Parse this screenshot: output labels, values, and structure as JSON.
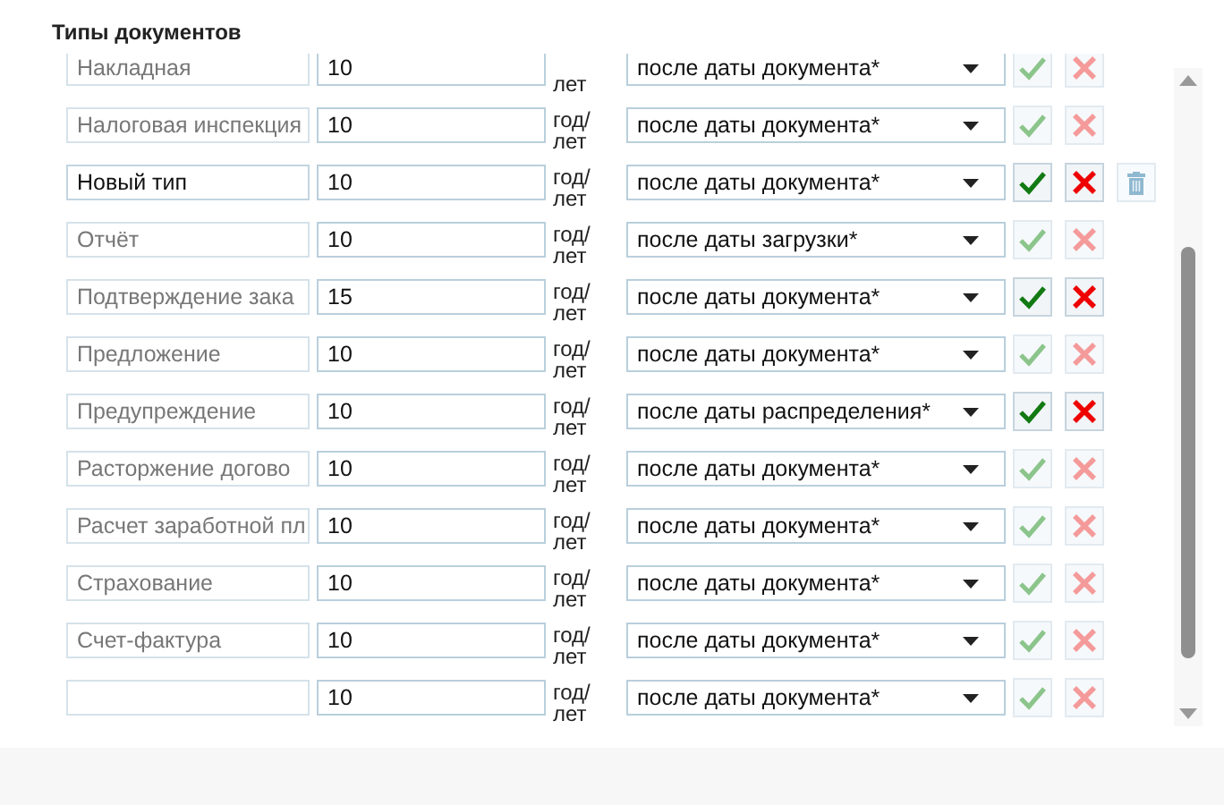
{
  "title": "Типы документов",
  "rows": [
    {
      "name": "Накладная",
      "editable": false,
      "years": "10",
      "unit": [
        "лет"
      ],
      "rule": "после даты документа*",
      "active": false,
      "deletable": false
    },
    {
      "name": "Налоговая инспекция",
      "editable": false,
      "years": "10",
      "unit": [
        "год/",
        "лет"
      ],
      "rule": "после даты документа*",
      "active": false,
      "deletable": false
    },
    {
      "name": "Новый тип",
      "editable": true,
      "years": "10",
      "unit": [
        "год/",
        "лет"
      ],
      "rule": "после даты документа*",
      "active": true,
      "deletable": true
    },
    {
      "name": "Отчёт",
      "editable": false,
      "years": "10",
      "unit": [
        "год/",
        "лет"
      ],
      "rule": "после даты загрузки*",
      "active": false,
      "deletable": false
    },
    {
      "name": "Подтверждение зака",
      "editable": false,
      "years": "15",
      "unit": [
        "год/",
        "лет"
      ],
      "rule": "после даты документа*",
      "active": true,
      "deletable": false
    },
    {
      "name": "Предложение",
      "editable": false,
      "years": "10",
      "unit": [
        "год/",
        "лет"
      ],
      "rule": "после даты документа*",
      "active": false,
      "deletable": false
    },
    {
      "name": "Предупреждение",
      "editable": false,
      "years": "10",
      "unit": [
        "год/",
        "лет"
      ],
      "rule": "после даты распределения*",
      "active": true,
      "deletable": false
    },
    {
      "name": "Расторжение догово",
      "editable": false,
      "years": "10",
      "unit": [
        "год/",
        "лет"
      ],
      "rule": "после даты документа*",
      "active": false,
      "deletable": false
    },
    {
      "name": "Расчет заработной пл",
      "editable": false,
      "years": "10",
      "unit": [
        "год/",
        "лет"
      ],
      "rule": "после даты документа*",
      "active": false,
      "deletable": false
    },
    {
      "name": "Страхование",
      "editable": false,
      "years": "10",
      "unit": [
        "год/",
        "лет"
      ],
      "rule": "после даты документа*",
      "active": false,
      "deletable": false
    },
    {
      "name": "Счет-фактура",
      "editable": false,
      "years": "10",
      "unit": [
        "год/",
        "лет"
      ],
      "rule": "после даты документа*",
      "active": false,
      "deletable": false
    },
    {
      "editable": false,
      "years": "10",
      "unit": [
        "год/",
        "лет"
      ],
      "rule": "после даты документа*",
      "active": false,
      "deletable": false
    }
  ]
}
